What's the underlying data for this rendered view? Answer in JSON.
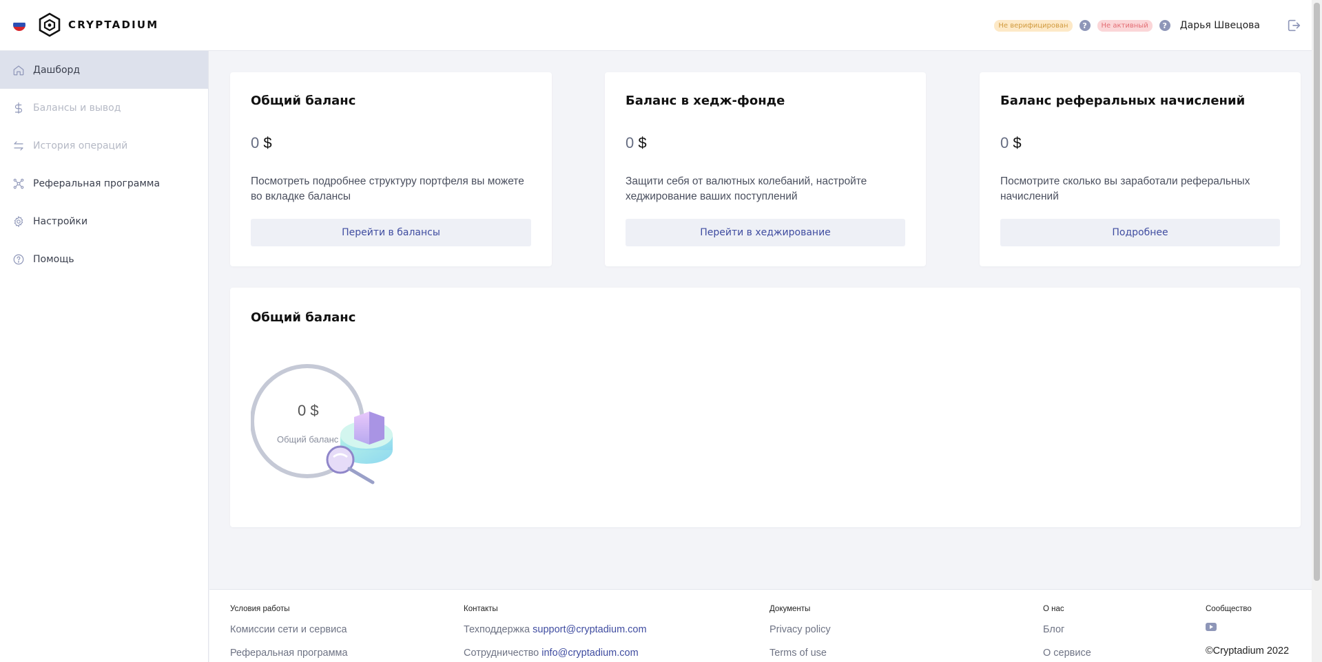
{
  "header": {
    "brand": "CRYPTADIUM",
    "flag_icon": "russian-flag-icon",
    "badge_unverified": "Не верифицирован",
    "badge_inactive": "Не активный",
    "help_mark": "?",
    "username": "Дарья Швецова",
    "logout_icon": "logout-icon"
  },
  "sidebar": {
    "items": [
      {
        "label": "Дашборд",
        "icon": "home-icon",
        "state": "active"
      },
      {
        "label": "Балансы и вывод",
        "icon": "dollar-icon",
        "state": "disabled"
      },
      {
        "label": "История операций",
        "icon": "exchange-arrows-icon",
        "state": "disabled"
      },
      {
        "label": "Реферальная программа",
        "icon": "referral-network-icon",
        "state": "normal"
      },
      {
        "label": "Настройки",
        "icon": "gear-icon",
        "state": "normal"
      },
      {
        "label": "Помощь",
        "icon": "help-circle-icon",
        "state": "normal"
      }
    ]
  },
  "cards": [
    {
      "title": "Общий баланс",
      "amount": "0",
      "currency": "$",
      "description": "Посмотреть подробнее структуру портфеля вы можете во вкладке балансы",
      "button": "Перейти в балансы"
    },
    {
      "title": "Баланс в хедж-фонде",
      "amount": "0",
      "currency": "$",
      "description": "Защити себя от валютных колебаний, настройте хеджирование ваших поступлений",
      "button": "Перейти в хеджирование"
    },
    {
      "title": "Баланс реферальных начислений",
      "amount": "0",
      "currency": "$",
      "description": "Посмотрите сколько вы заработали реферальных начислений",
      "button": "Подробнее"
    }
  ],
  "overview": {
    "title": "Общий баланс",
    "amount": "0 $",
    "label": "Общий баланс"
  },
  "footer": {
    "columns": [
      {
        "heading": "Условия работы",
        "links": [
          "Комиссии сети и сервиса",
          "Реферальная программа"
        ]
      },
      {
        "heading": "Контакты",
        "links": [
          {
            "label": "Техподдержка",
            "email": "support@cryptadium.com"
          },
          {
            "label": "Сотрудничество",
            "email": "info@cryptadium.com"
          }
        ]
      },
      {
        "heading": "Документы",
        "links": [
          "Privacy policy",
          "Terms of use"
        ]
      },
      {
        "heading": "О нас",
        "links": [
          "Блог",
          "О сервисе"
        ]
      },
      {
        "heading": "Сообщество",
        "icon": "youtube-icon",
        "copyright": "©Cryptadium 2022"
      }
    ]
  },
  "colors": {
    "accent": "#3f4ca0",
    "active_nav_bg": "#dde1ec",
    "badge_warning_bg": "#fde9c7",
    "badge_error_bg": "#fbd6d8",
    "page_bg": "#f3f4f8"
  }
}
